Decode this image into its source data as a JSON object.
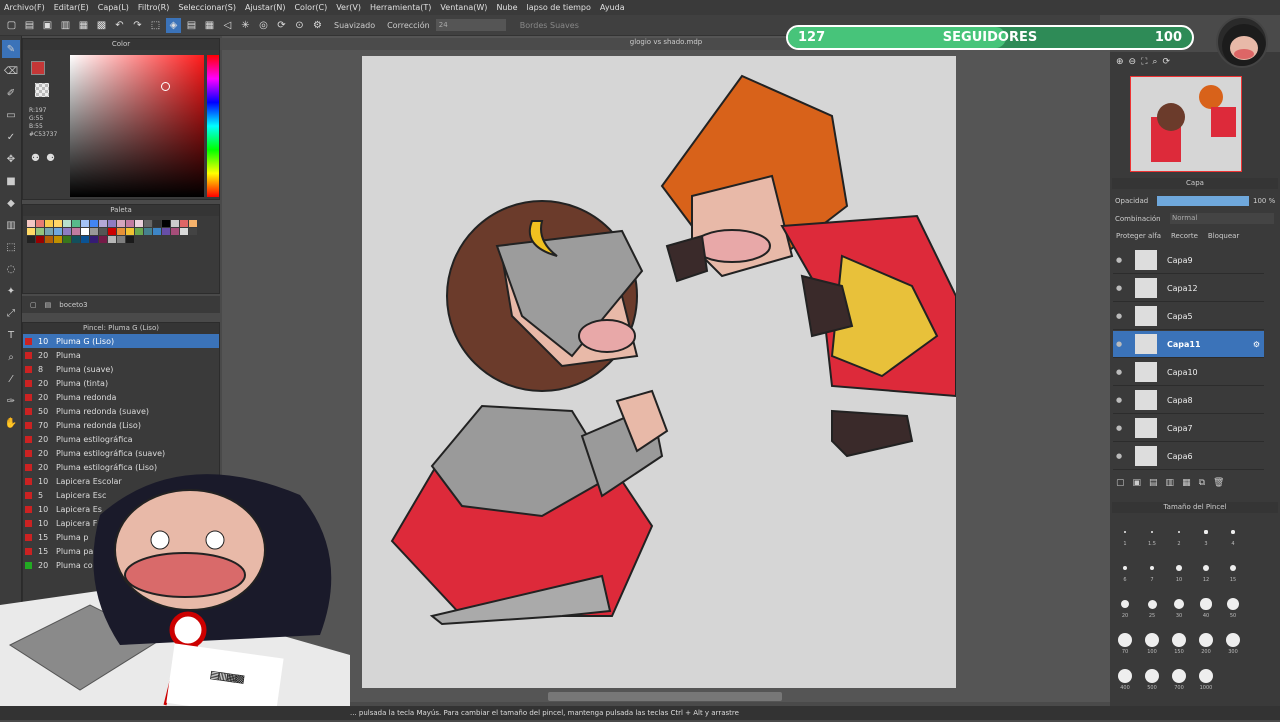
{
  "menu": [
    "Archivo(F)",
    "Editar(E)",
    "Capa(L)",
    "Filtro(R)",
    "Seleccionar(S)",
    "Ajustar(N)",
    "Color(C)",
    "Ver(V)",
    "Herramienta(T)",
    "Ventana(W)",
    "Nube",
    "lapso de tiempo",
    "Ayuda"
  ],
  "toolbar": {
    "smooth_label": "Suavizado",
    "correction_label": "Corrección",
    "correction_value": "24",
    "soft_edges_label": "Bordes Suaves"
  },
  "document_title": "glogio vs shado.mdp",
  "color_panel": {
    "title": "Color",
    "r": "R:197",
    "g": "G:55",
    "b": "B:55",
    "hex": "#C53737",
    "fg": "#c53737"
  },
  "palette_panel": {
    "title": "Paleta",
    "swatches": [
      "#f4c7c3",
      "#e67c73",
      "#f7cb4d",
      "#ffd666",
      "#b7e1cd",
      "#57bb8a",
      "#a4c2f4",
      "#4285f4",
      "#b4a7d6",
      "#8e7cc3",
      "#d5a6bd",
      "#c27ba0",
      "#ead1dc",
      "#666666",
      "#333333",
      "#000000",
      "#cccccc",
      "#e06666",
      "#f6b26b",
      "#ffd966",
      "#93c47d",
      "#76a5af",
      "#6fa8dc",
      "#8e7cc3",
      "#c27ba0",
      "#ffffff",
      "#999999",
      "#555555",
      "#cc0000",
      "#e69138",
      "#f1c232",
      "#6aa84f",
      "#45818e",
      "#3d85c6",
      "#674ea7",
      "#a64d79",
      "#d9d9d9",
      "#434343",
      "#222222",
      "#990000",
      "#b45f06",
      "#bf9000",
      "#38761d",
      "#134f5c",
      "#0b5394",
      "#351c75",
      "#741b47",
      "#b7b7b7",
      "#7f7f7f",
      "#1a1a1a"
    ]
  },
  "sublayer": {
    "name": "boceto3"
  },
  "brush_panel": {
    "title": "Pincel: Pluma G (Liso)",
    "items": [
      {
        "size": "10",
        "name": "Pluma G (Liso)",
        "color": "#cc2222"
      },
      {
        "size": "20",
        "name": "Pluma",
        "color": "#cc2222"
      },
      {
        "size": "8",
        "name": "Pluma (suave)",
        "color": "#cc2222"
      },
      {
        "size": "20",
        "name": "Pluma (tinta)",
        "color": "#cc2222"
      },
      {
        "size": "20",
        "name": "Pluma redonda",
        "color": "#cc2222"
      },
      {
        "size": "50",
        "name": "Pluma redonda (suave)",
        "color": "#cc2222"
      },
      {
        "size": "70",
        "name": "Pluma redonda (Liso)",
        "color": "#cc2222"
      },
      {
        "size": "20",
        "name": "Pluma estilográfica",
        "color": "#cc2222"
      },
      {
        "size": "20",
        "name": "Pluma estilográfica (suave)",
        "color": "#cc2222"
      },
      {
        "size": "20",
        "name": "Pluma estilográfica (Liso)",
        "color": "#cc2222"
      },
      {
        "size": "10",
        "name": "Lapicera Escolar",
        "color": "#cc2222"
      },
      {
        "size": "5",
        "name": "Lapicera Esc",
        "color": "#cc2222"
      },
      {
        "size": "10",
        "name": "Lapicera Es",
        "color": "#cc2222"
      },
      {
        "size": "10",
        "name": "Lapicera F",
        "color": "#cc2222"
      },
      {
        "size": "15",
        "name": "Pluma p",
        "color": "#cc2222"
      },
      {
        "size": "15",
        "name": "Pluma pa",
        "color": "#cc2222"
      },
      {
        "size": "20",
        "name": "Pluma co",
        "color": "#22aa22"
      }
    ]
  },
  "followers": {
    "left": "127",
    "label": "SEGUIDORES",
    "right": "100",
    "progress": 0.54
  },
  "layer_panel": {
    "title": "Capa",
    "opacity_label": "Opacidad",
    "opacity_value": "100 %",
    "blend_label": "Combinación",
    "blend_value": "Normal",
    "protect_alpha": "Proteger alfa",
    "clip": "Recorte",
    "lock": "Bloquear",
    "layers": [
      "Capa9",
      "Capa12",
      "Capa5",
      "Capa11",
      "Capa10",
      "Capa8",
      "Capa7",
      "Capa6"
    ],
    "selected": "Capa11"
  },
  "brush_size_panel": {
    "title": "Tamaño del Pincel",
    "sizes": [
      "1",
      "1.5",
      "2",
      "3",
      "4",
      "6",
      "7",
      "10",
      "12",
      "15",
      "20",
      "25",
      "30",
      "40",
      "50",
      "70",
      "100",
      "150",
      "200",
      "300",
      "400",
      "500",
      "700",
      "1000"
    ]
  },
  "status": "... pulsada la tecla Mayús. Para cambiar el tamaño del pincel, mantenga pulsada las teclas Ctrl + Alt y arrastre"
}
